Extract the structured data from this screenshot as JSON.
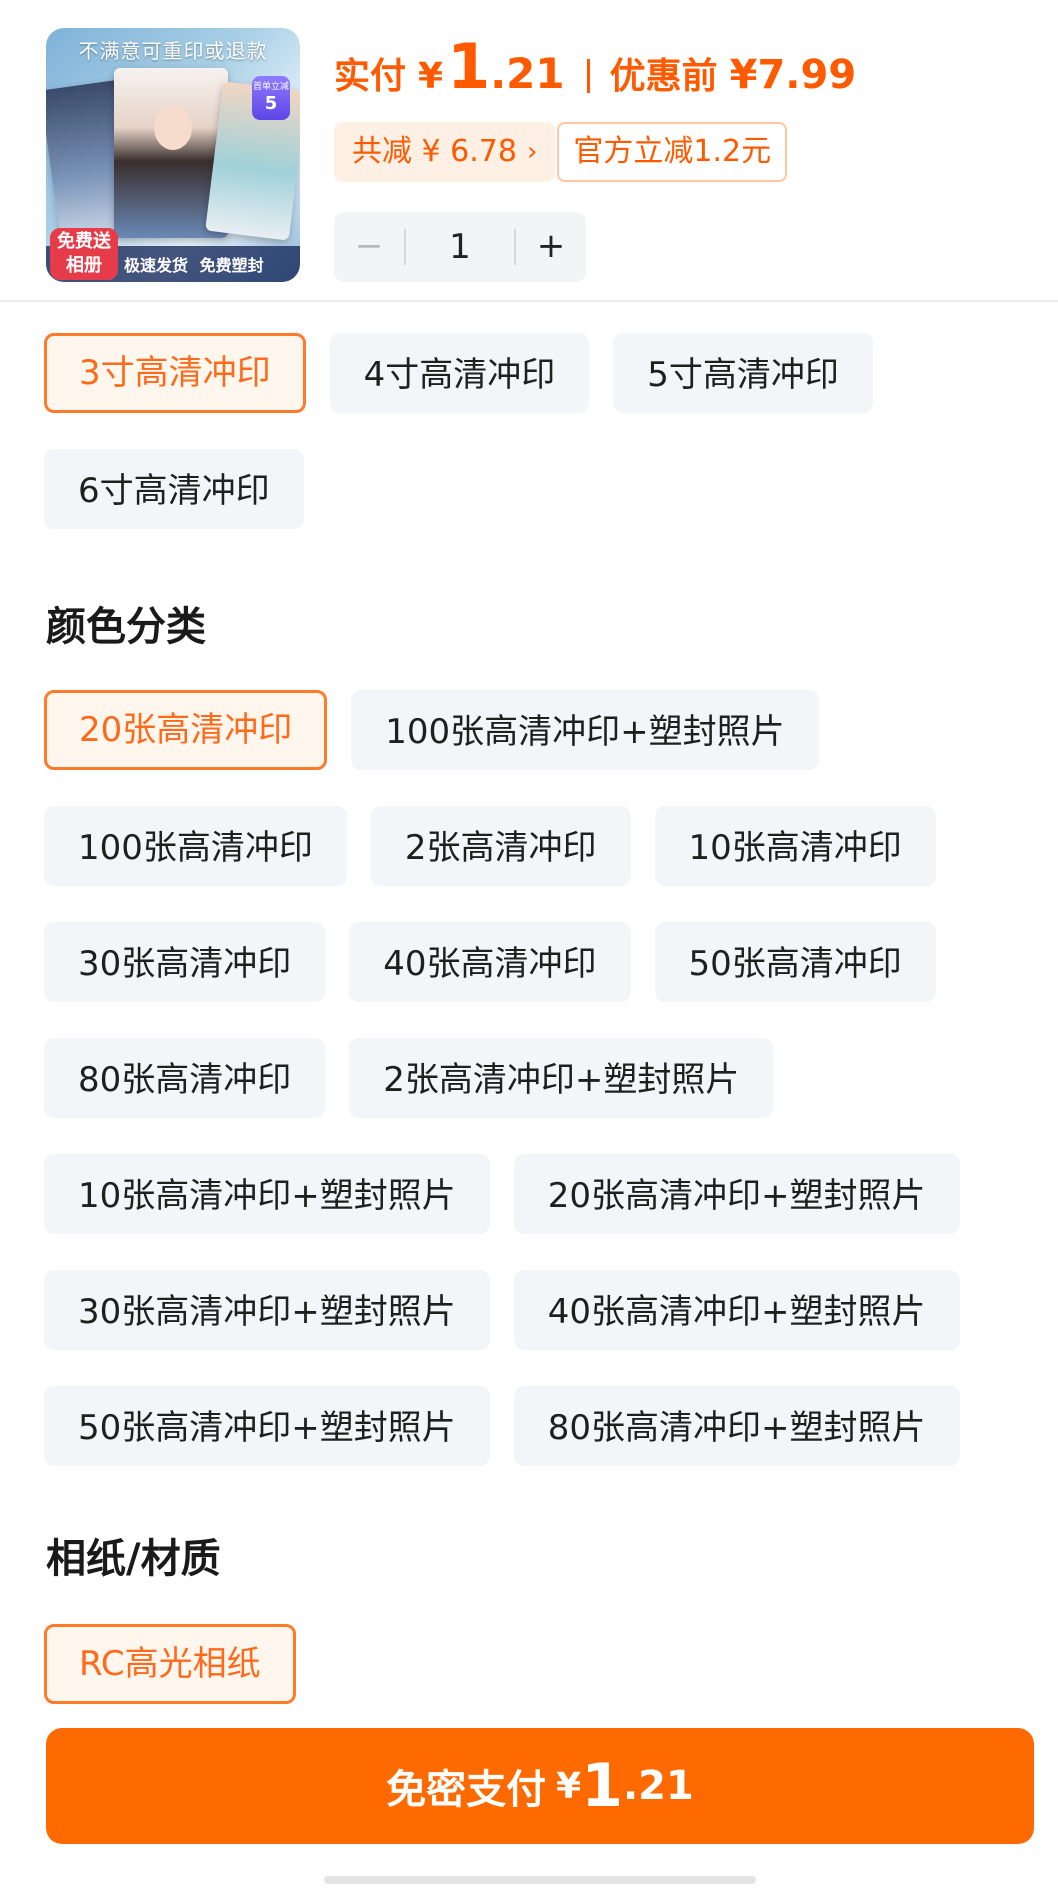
{
  "product": {
    "thumbnail": {
      "banner_text": "不满意可重印或退款",
      "badge_top": "首单立减",
      "badge_number": "5",
      "gift_text": "免费送相册",
      "bottom_text": "极速发货 免费塑封"
    },
    "price": {
      "paid_label": "实付",
      "currency": "¥",
      "paid_integer": "1",
      "paid_decimal": ".21",
      "original_label": "优惠前",
      "original_value": "¥7.99"
    },
    "discount": {
      "total_text": "共减 ¥ 6.78",
      "chevron": "›",
      "official_text": "官方立减1.2元"
    },
    "quantity": {
      "minus": "−",
      "value": "1",
      "plus": "+"
    }
  },
  "size_options": {
    "items": [
      {
        "label": "3寸高清冲印",
        "selected": true
      },
      {
        "label": "4寸高清冲印",
        "selected": false
      },
      {
        "label": "5寸高清冲印",
        "selected": false
      },
      {
        "label": "6寸高清冲印",
        "selected": false
      }
    ]
  },
  "color_section": {
    "title": "颜色分类",
    "items": [
      {
        "label": "20张高清冲印",
        "selected": true
      },
      {
        "label": "100张高清冲印+塑封照片",
        "selected": false
      },
      {
        "label": "100张高清冲印",
        "selected": false
      },
      {
        "label": "2张高清冲印",
        "selected": false
      },
      {
        "label": "10张高清冲印",
        "selected": false
      },
      {
        "label": "30张高清冲印",
        "selected": false
      },
      {
        "label": "40张高清冲印",
        "selected": false
      },
      {
        "label": "50张高清冲印",
        "selected": false
      },
      {
        "label": "80张高清冲印",
        "selected": false
      },
      {
        "label": "2张高清冲印+塑封照片",
        "selected": false
      },
      {
        "label": "10张高清冲印+塑封照片",
        "selected": false
      },
      {
        "label": "20张高清冲印+塑封照片",
        "selected": false
      },
      {
        "label": "30张高清冲印+塑封照片",
        "selected": false
      },
      {
        "label": "40张高清冲印+塑封照片",
        "selected": false
      },
      {
        "label": "50张高清冲印+塑封照片",
        "selected": false
      },
      {
        "label": "80张高清冲印+塑封照片",
        "selected": false
      }
    ]
  },
  "material_section": {
    "title": "相纸/材质",
    "items": [
      {
        "label": "RC高光相纸",
        "selected": true
      }
    ]
  },
  "pay_button": {
    "label": "免密支付",
    "currency": "¥",
    "integer": "1",
    "decimal": ".21"
  },
  "colors": {
    "accent": "#ff6a00",
    "selected_border": "#ff7a2a",
    "option_bg": "#f3f5f8"
  }
}
